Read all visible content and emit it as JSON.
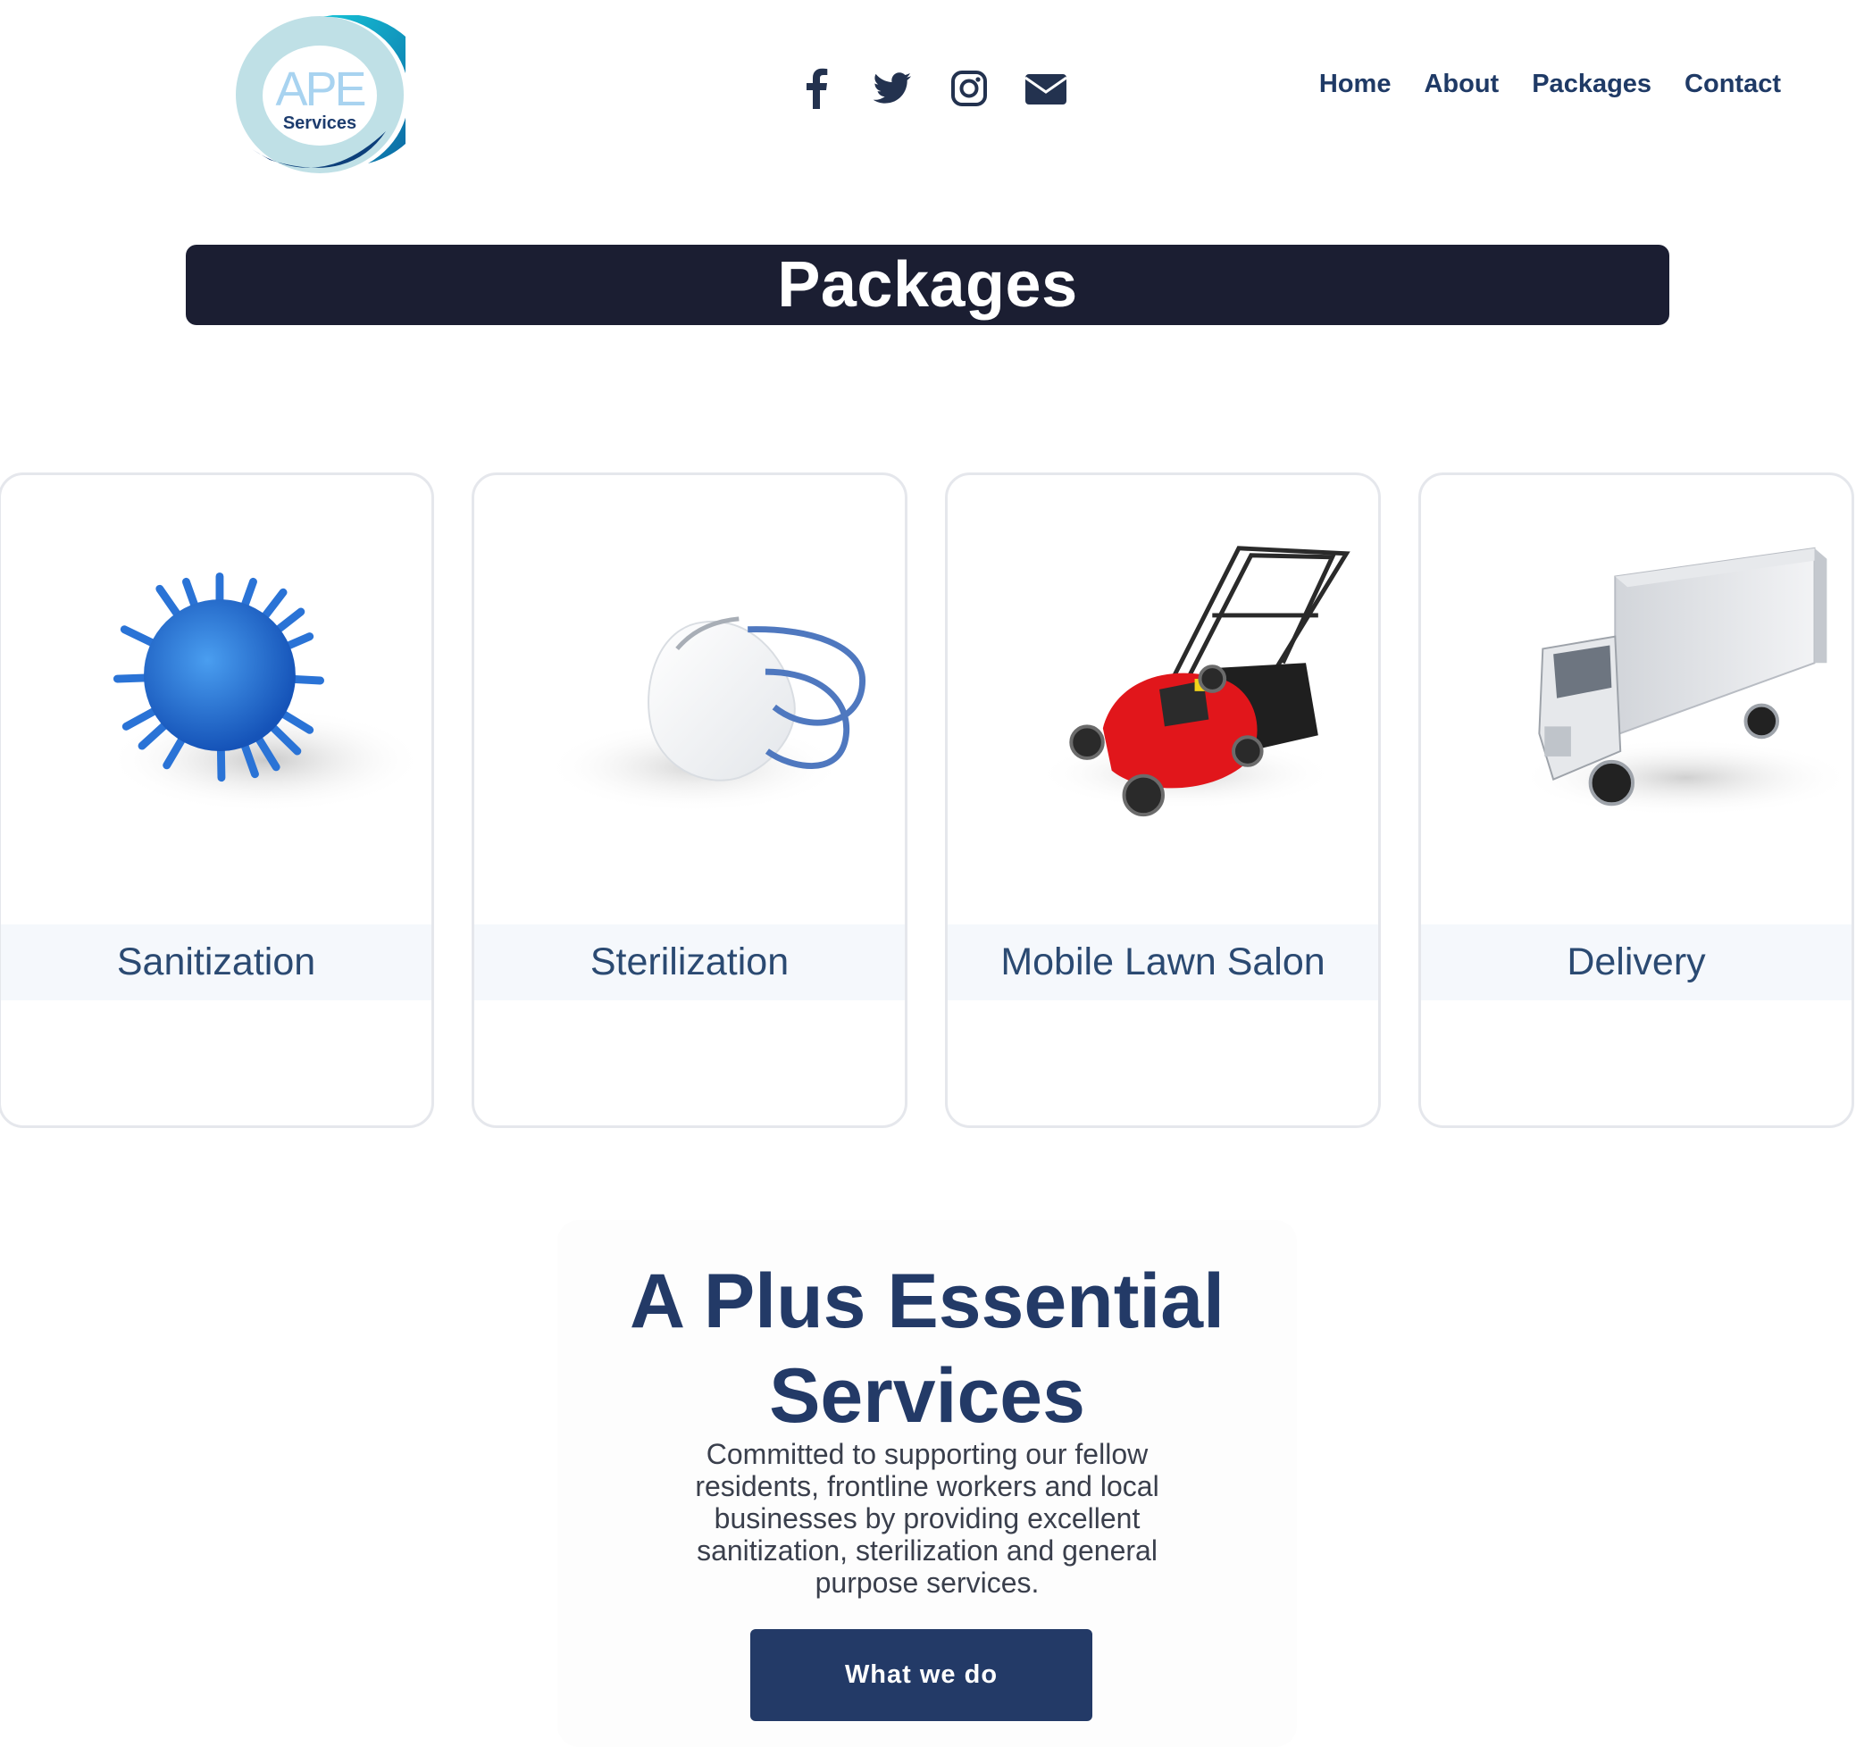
{
  "header": {
    "logo": {
      "brand_text": "APE",
      "sub_text": "Services"
    },
    "social": [
      {
        "icon": "facebook-icon"
      },
      {
        "icon": "twitter-icon"
      },
      {
        "icon": "instagram-icon"
      },
      {
        "icon": "envelope-icon"
      }
    ],
    "nav": [
      "Home",
      "About",
      "Packages",
      "Contact"
    ]
  },
  "packages": {
    "title": "Packages",
    "cards": [
      {
        "label": "Sanitization",
        "image": "virus-image"
      },
      {
        "label": "Sterilization",
        "image": "face-mask-image"
      },
      {
        "label": "Mobile Lawn Salon",
        "image": "lawn-mower-image"
      },
      {
        "label": "Delivery",
        "image": "box-truck-image"
      }
    ]
  },
  "hero": {
    "title_line1": "A Plus Essential",
    "title_line2": "Services",
    "description": "Committed to supporting our fellow residents, frontline workers and local businesses by providing excellent sanitization, sterilization and general purpose services.",
    "button": "What we do"
  },
  "colors": {
    "navy": "#233a67",
    "title_bar": "#1b1e32",
    "card_border": "#e5e7ec",
    "label_band": "#f5f8fc"
  }
}
